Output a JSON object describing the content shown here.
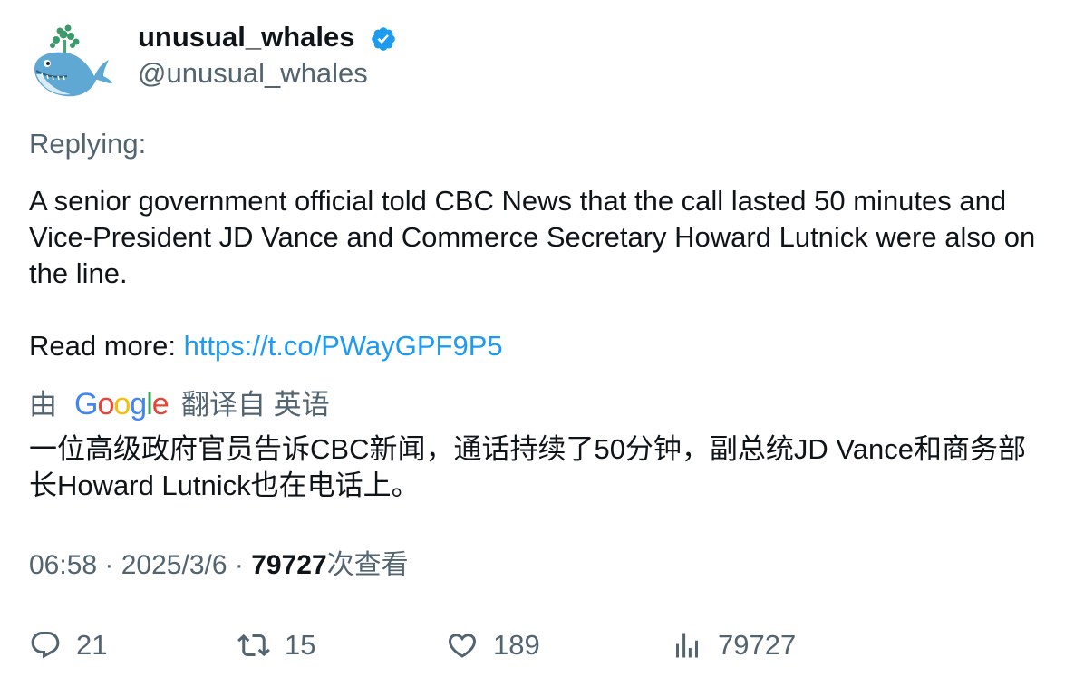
{
  "author": {
    "display_name": "unusual_whales",
    "handle": "@unusual_whales",
    "verified": true
  },
  "replying_label": "Replying:",
  "tweet": {
    "text": "A senior government official told CBC News that the call lasted 50 minutes and Vice-President JD Vance and Commerce Secretary Howard Lutnick were also on the line.",
    "read_more_label": "Read more: ",
    "link": "https://t.co/PWayGPF9P5"
  },
  "translation": {
    "by_label": "由",
    "google_letters": [
      {
        "char": "G",
        "color": "#4285f4"
      },
      {
        "char": "o",
        "color": "#ea4335"
      },
      {
        "char": "o",
        "color": "#fbbc05"
      },
      {
        "char": "g",
        "color": "#4285f4"
      },
      {
        "char": "l",
        "color": "#34a853"
      },
      {
        "char": "e",
        "color": "#ea4335"
      }
    ],
    "source_label": "翻译自 英语",
    "text": "一位高级政府官员告诉CBC新闻，通话持续了50分钟，副总统JD Vance和商务部长Howard Lutnick也在电话上。"
  },
  "meta": {
    "time": "06:58",
    "separator": " · ",
    "date": "2025/3/6",
    "views_count": "79727",
    "views_label": "次查看"
  },
  "actions": {
    "replies": "21",
    "retweets": "15",
    "likes": "189",
    "views": "79727"
  },
  "colors": {
    "text_primary": "#0f1419",
    "text_secondary": "#536471",
    "link": "#1d9bf0",
    "verified_badge": "#1d9bf0",
    "whale_blue": "#5fa8d3",
    "spout_green": "#3c9a6a"
  },
  "icons": [
    "whale-avatar",
    "verified-badge-icon",
    "reply-icon",
    "retweet-icon",
    "like-icon",
    "views-icon"
  ]
}
